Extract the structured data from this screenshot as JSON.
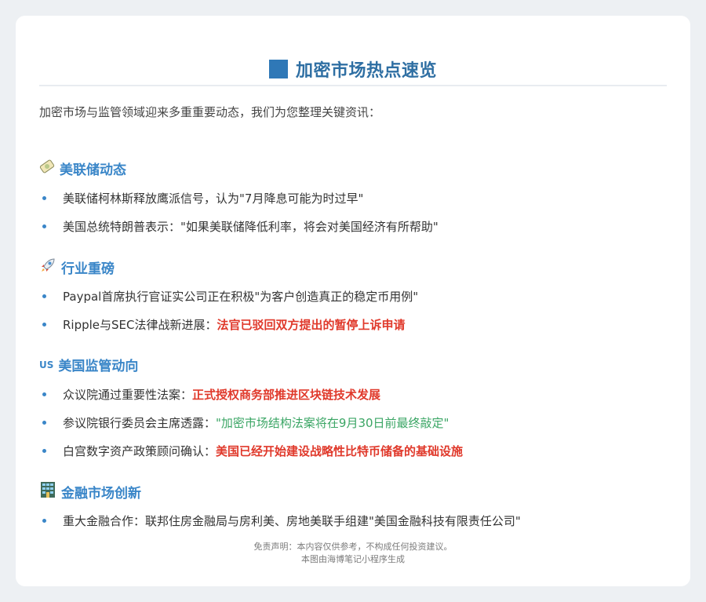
{
  "title": "加密市场热点速览",
  "intro": "加密市场与监管领域迎来多重重要动态，我们为您整理关键资讯：",
  "sections": [
    {
      "icon": "dove-icon",
      "heading": "美联储动态",
      "items": [
        {
          "text": "美联储柯林斯释放鹰派信号，认为\"7月降息可能为时过早\""
        },
        {
          "text": "美国总统特朗普表示：\"如果美联储降低利率，将会对美国经济有所帮助\""
        }
      ]
    },
    {
      "icon": "rocket-icon",
      "heading": "行业重磅",
      "items": [
        {
          "text": "Paypal首席执行官证实公司正在积极\"为客户创造真正的稳定币用例\""
        },
        {
          "text": "Ripple与SEC法律战新进展：",
          "highlight": "法官已驳回双方提出的暂停上诉申请"
        }
      ]
    },
    {
      "icon": "us-flag-icon",
      "icon_text": "US",
      "heading": "美国监管动向",
      "items": [
        {
          "text": "众议院通过重要性法案：",
          "highlight": "正式授权商务部推进区块链技术发展"
        },
        {
          "text": "参议院银行委员会主席透露：",
          "highlight_green": "\"加密市场结构法案将在9月30日前最终敲定\""
        },
        {
          "text": "白宫数字资产政策顾问确认：",
          "highlight": "美国已经开始建设战略性比特币储备的基础设施"
        }
      ]
    },
    {
      "icon": "office-building-icon",
      "heading": "金融市场创新",
      "items": [
        {
          "text": "重大金融合作：联邦住房金融局与房利美、房地美联手组建\"美国金融科技有限责任公司\""
        }
      ]
    }
  ],
  "footer": {
    "disclaimer": "免责声明：本内容仅供参考，不构成任何投资建议。",
    "generated_by": "本图由海博笔记小程序生成"
  },
  "colors": {
    "accent": "#3a86c8",
    "title": "#2f6fa3",
    "highlight_red": "#e0392b",
    "highlight_green": "#3aa564"
  }
}
